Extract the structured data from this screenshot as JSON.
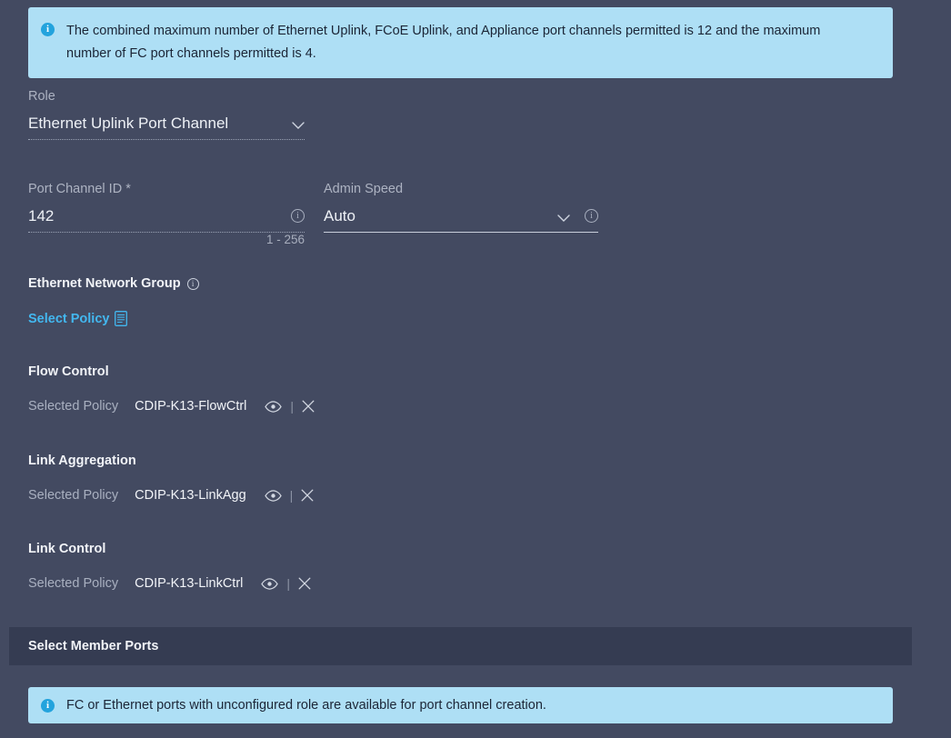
{
  "banners": {
    "top": {
      "icon": "info-circle-icon",
      "text": "The combined maximum number of Ethernet Uplink, FCoE Uplink, and Appliance port channels permitted is 12 and the maximum number of FC port channels permitted is 4."
    },
    "bottom": {
      "icon": "info-circle-icon",
      "text": "FC or Ethernet ports with unconfigured role are available for port channel creation."
    }
  },
  "form": {
    "role": {
      "label": "Role",
      "value": "Ethernet Uplink Port Channel",
      "icon": "chevron-down-icon"
    },
    "port_channel_id": {
      "label": "Port Channel ID *",
      "value": "142",
      "hint": "1 - 256",
      "info_icon": "info-circle-icon"
    },
    "admin_speed": {
      "label": "Admin Speed",
      "value": "Auto",
      "chevron_icon": "chevron-down-icon",
      "info_icon": "info-circle-icon"
    }
  },
  "ethernet_network_group": {
    "title": "Ethernet Network Group",
    "info_icon": "info-circle-icon",
    "select_policy_label": "Select Policy",
    "select_policy_icon": "document-list-icon"
  },
  "policies": [
    {
      "title": "Flow Control",
      "selected_label": "Selected Policy",
      "name": "CDIP-K13-FlowCtrl",
      "view_icon": "eye-icon",
      "remove_icon": "close-x-icon"
    },
    {
      "title": "Link Aggregation",
      "selected_label": "Selected Policy",
      "name": "CDIP-K13-LinkAgg",
      "view_icon": "eye-icon",
      "remove_icon": "close-x-icon"
    },
    {
      "title": "Link Control",
      "selected_label": "Selected Policy",
      "name": "CDIP-K13-LinkCtrl",
      "view_icon": "eye-icon",
      "remove_icon": "close-x-icon"
    }
  ],
  "member_ports": {
    "title": "Select Member Ports"
  },
  "colors": {
    "background": "#434a61",
    "banner_background": "#aedff5",
    "banner_text": "#1b2536",
    "accent_blue": "#43b7ef",
    "info_icon_blue": "#23a3dd",
    "section_header_background": "#353c52",
    "label_muted": "#a9b0c0",
    "text_primary": "#f2f4f8"
  }
}
